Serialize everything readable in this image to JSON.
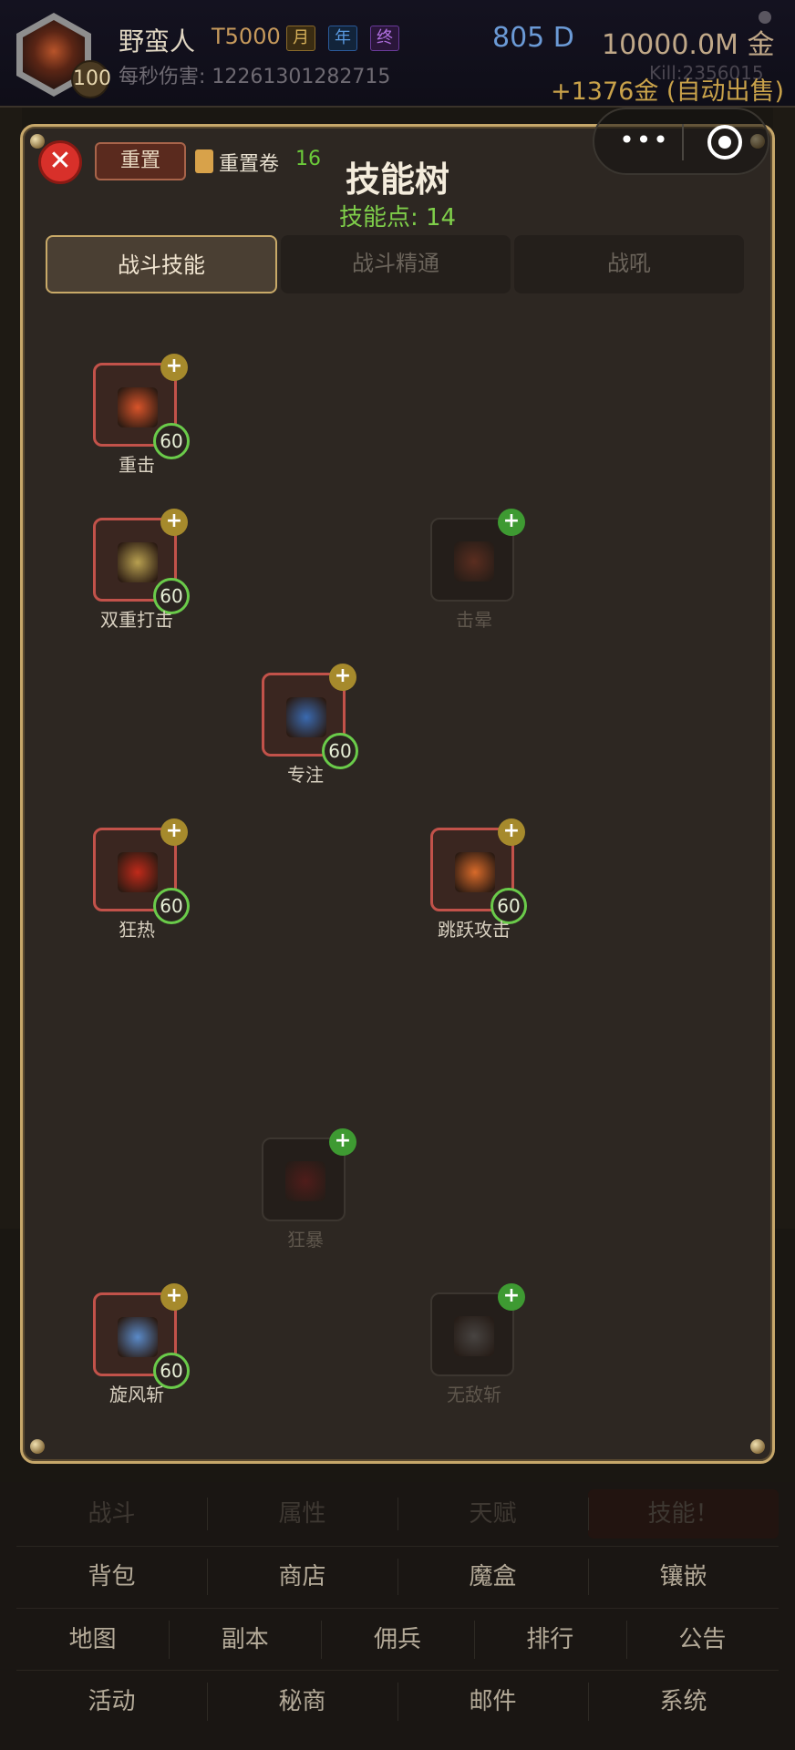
{
  "header": {
    "player_name": "野蛮人",
    "tier": "T5000",
    "tag_month": "月",
    "tag_year": "年",
    "tag_end": "终",
    "level": "100",
    "dps_label": "每秒伤害: 12261301282715",
    "currency_d": "805 D",
    "currency_gold": "10000.0M 金",
    "kill": "Kill:2356015",
    "gold_gain": "+1376金 (自动出售)"
  },
  "panel": {
    "title": "技能树",
    "skill_points": "技能点: 14",
    "reset_label": "重置",
    "scroll_label": "重置卷",
    "scroll_count": "16",
    "close_symbol": "✕",
    "capsule_more": "•••",
    "tabs": [
      {
        "label": "战斗技能",
        "active": true
      },
      {
        "label": "战斗精通",
        "active": false
      },
      {
        "label": "战吼",
        "active": false
      }
    ]
  },
  "skills": [
    {
      "name": "重击",
      "level": "60",
      "plus": "+",
      "locked": false,
      "icon": "heavy-strike-icon",
      "color": "#d8542a"
    },
    {
      "name": "双重打击",
      "level": "60",
      "plus": "+",
      "locked": false,
      "icon": "double-swing-icon",
      "color": "#b8a050"
    },
    {
      "name": "击晕",
      "level": "",
      "plus": "+",
      "locked": true,
      "icon": "stun-icon",
      "color": "#c04a2a"
    },
    {
      "name": "专注",
      "level": "60",
      "plus": "+",
      "locked": false,
      "icon": "concentrate-icon",
      "color": "#3a6ab0"
    },
    {
      "name": "狂热",
      "level": "60",
      "plus": "+",
      "locked": false,
      "icon": "frenzy-icon",
      "color": "#c02a1a"
    },
    {
      "name": "跳跃攻击",
      "level": "60",
      "plus": "+",
      "locked": false,
      "icon": "leap-attack-icon",
      "color": "#d86a2a"
    },
    {
      "name": "狂暴",
      "level": "",
      "plus": "+",
      "locked": true,
      "icon": "berserk-icon",
      "color": "#a01a1a"
    },
    {
      "name": "旋风斩",
      "level": "60",
      "plus": "+",
      "locked": false,
      "icon": "whirlwind-icon",
      "color": "#5a8ac8"
    },
    {
      "name": "无敌斩",
      "level": "",
      "plus": "+",
      "locked": true,
      "icon": "invincible-slash-icon",
      "color": "#8a8a8a"
    }
  ],
  "nav": {
    "row1": [
      "战斗",
      "属性",
      "天赋",
      "技能！"
    ],
    "row2": [
      "背包",
      "商店",
      "魔盒",
      "镶嵌"
    ],
    "row3": [
      "地图",
      "副本",
      "佣兵",
      "排行",
      "公告"
    ],
    "row4": [
      "活动",
      "秘商",
      "邮件",
      "系统"
    ]
  }
}
